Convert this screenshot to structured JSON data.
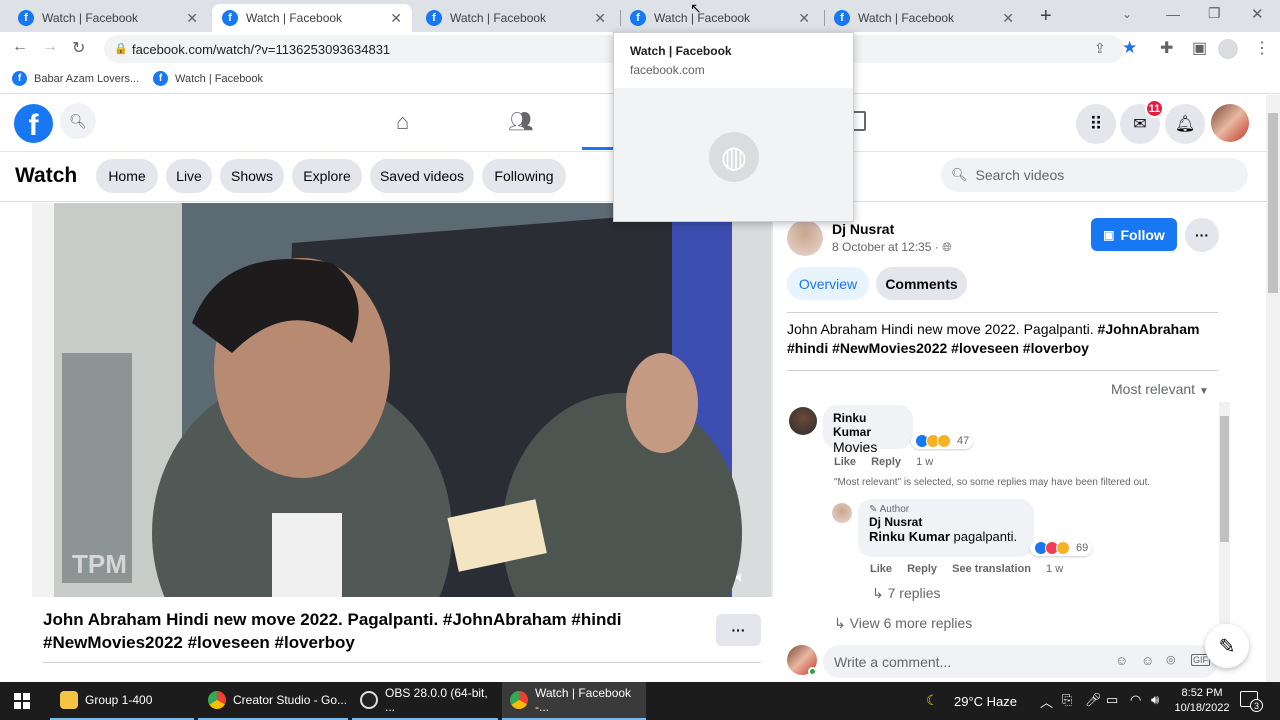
{
  "browser": {
    "tabs": [
      {
        "title": "Watch | Facebook"
      },
      {
        "title": "Watch | Facebook"
      },
      {
        "title": "Watch | Facebook"
      },
      {
        "title": "Watch | Facebook"
      },
      {
        "title": "Watch | Facebook"
      }
    ],
    "url": "facebook.com/watch/?v=1136253093634831",
    "bookmarks": [
      "Babar Azam Lovers...",
      "Watch | Facebook"
    ],
    "tab_preview": {
      "title": "Watch | Facebook",
      "domain": "facebook.com"
    }
  },
  "header": {
    "messenger_badge": "11"
  },
  "watch": {
    "title": "Watch",
    "nav": [
      "Home",
      "Live",
      "Shows",
      "Explore",
      "Saved videos",
      "Following"
    ],
    "search_placeholder": "Search videos"
  },
  "video": {
    "watermark": "TPM",
    "caption": "John Abraham Hindi new move 2022. Pagalpanti. #JohnAbraham #hindi #NewMovies2022 #loveseen #loverboy",
    "more": "···"
  },
  "post": {
    "author": "Dj Nusrat",
    "date": "8 October at 12:35 ·",
    "follow_label": "Follow",
    "tabs": [
      "Overview",
      "Comments"
    ],
    "description_plain": "John Abraham Hindi new move 2022. Pagalpanti. ",
    "description_tags1": "#JohnAbraham",
    "description_tags2": "#hindi #NewMovies2022 #loveseen #loverboy",
    "sort_label": "Most relevant"
  },
  "comments": {
    "c1": {
      "name": "Rinku Kumar",
      "text": "Movies",
      "count": "47",
      "like": "Like",
      "reply": "Reply",
      "time": "1 w"
    },
    "filter_note": "\"Most relevant\" is selected, so some replies may have been filtered out.",
    "c2": {
      "badge": "Author",
      "name": "Dj Nusrat",
      "mention": "Rinku Kumar",
      "text": " pagalpanti.",
      "count": "69",
      "like": "Like",
      "reply": "Reply",
      "translate": "See translation",
      "time": "1 w"
    },
    "replies": "7 replies",
    "more_replies": "View 6 more replies",
    "write_placeholder": "Write a comment..."
  },
  "taskbar": {
    "apps": [
      "Group 1-400",
      "Creator Studio - Go...",
      "OBS 28.0.0 (64-bit, ...",
      "Watch | Facebook -..."
    ],
    "weather": "29°C  Haze",
    "time": "8:52 PM",
    "date": "10/18/2022",
    "notif": "3"
  },
  "colors": {
    "fb_blue": "#1877f2",
    "taskbar": "#1c1c1c",
    "tab_bg": "#dee1e6"
  }
}
